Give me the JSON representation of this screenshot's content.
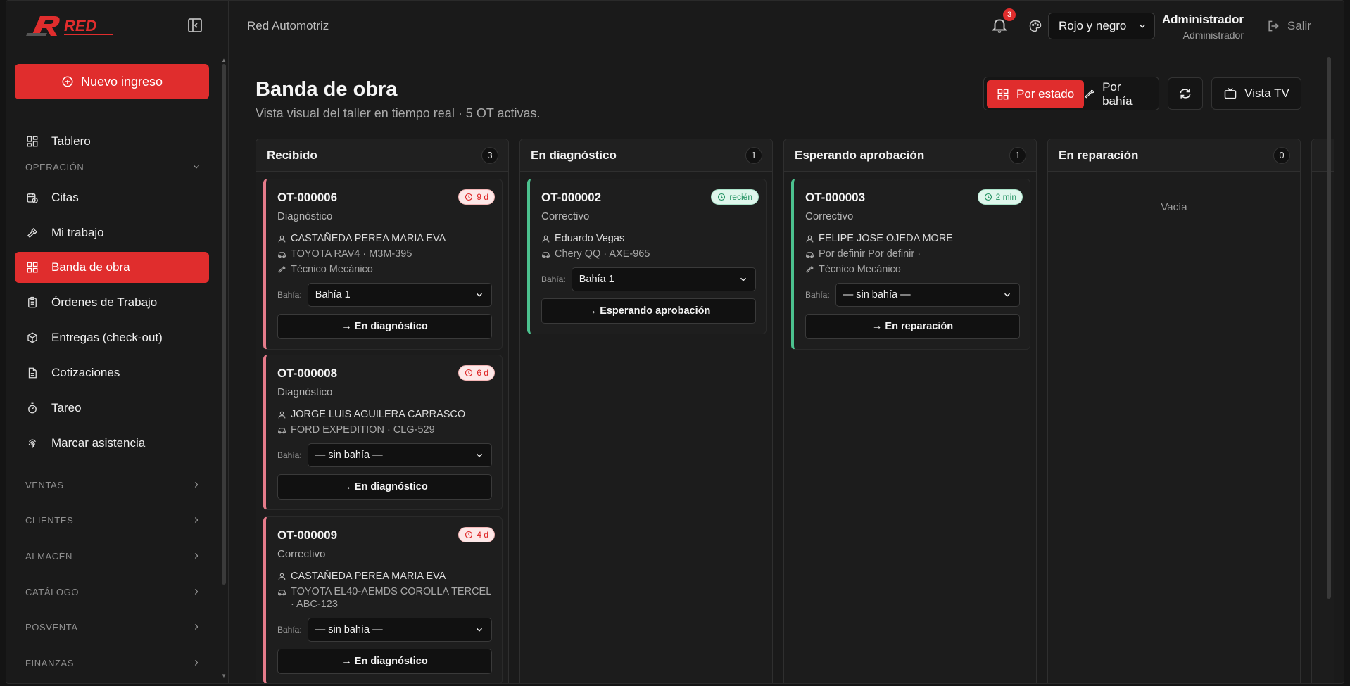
{
  "app": {
    "title": "Red Automotriz",
    "logo_text": "RED"
  },
  "sidebar": {
    "new_button": "Nuevo ingreso",
    "dashboard": "Tablero",
    "sections": [
      {
        "label": "OPERACIÓN",
        "expanded": true
      },
      {
        "label": "VENTAS"
      },
      {
        "label": "CLIENTES"
      },
      {
        "label": "ALMACÉN"
      },
      {
        "label": "CATÁLOGO"
      },
      {
        "label": "POSVENTA"
      },
      {
        "label": "FINANZAS"
      }
    ],
    "items": [
      {
        "label": "Citas",
        "icon": "calendar-clock-icon"
      },
      {
        "label": "Mi trabajo",
        "icon": "hammer-icon"
      },
      {
        "label": "Banda de obra",
        "icon": "grid-icon",
        "active": true
      },
      {
        "label": "Órdenes de Trabajo",
        "icon": "clipboard-icon"
      },
      {
        "label": "Entregas (check-out)",
        "icon": "package-icon"
      },
      {
        "label": "Cotizaciones",
        "icon": "document-icon"
      },
      {
        "label": "Tareo",
        "icon": "timer-icon"
      },
      {
        "label": "Marcar asistencia",
        "icon": "fingerprint-icon"
      }
    ]
  },
  "topbar": {
    "notifications_count": "3",
    "theme": "Rojo y negro",
    "user_name": "Administrador",
    "user_role": "Administrador",
    "logout": "Salir"
  },
  "page": {
    "title": "Banda de obra",
    "subtitle": "Vista visual del taller en tiempo real · 5 OT activas.",
    "view_by_status": "Por estado",
    "view_by_bay": "Por bahía",
    "tv_view": "Vista TV"
  },
  "bay_label": "Bahía:",
  "columns": [
    {
      "title": "Recibido",
      "count": "3",
      "cards": [
        {
          "id": "OT-000006",
          "time": "9 d",
          "type": "Diagnóstico",
          "client": "CASTAÑEDA PEREA MARIA EVA",
          "vehicle": "TOYOTA RAV4 · M3M-395",
          "tech": "Técnico Mecánico",
          "bay": "Bahía 1",
          "action": "→ En diagnóstico"
        },
        {
          "id": "OT-000008",
          "time": "6 d",
          "type": "Diagnóstico",
          "client": "JORGE LUIS AGUILERA CARRASCO",
          "vehicle": "FORD EXPEDITION · CLG-529",
          "bay": "— sin bahía —",
          "action": "→ En diagnóstico"
        },
        {
          "id": "OT-000009",
          "time": "4 d",
          "type": "Correctivo",
          "client": "CASTAÑEDA PEREA MARIA EVA",
          "vehicle": "TOYOTA EL40-AEMDS COROLLA TERCEL · ABC-123",
          "bay": "— sin bahía —",
          "action": "→ En diagnóstico"
        }
      ]
    },
    {
      "title": "En diagnóstico",
      "count": "1",
      "cards": [
        {
          "id": "OT-000002",
          "time": "recién",
          "type": "Correctivo",
          "client": "Eduardo Vegas",
          "vehicle": "Chery QQ · AXE-965",
          "bay": "Bahía 1",
          "action": "→ Esperando aprobación"
        }
      ]
    },
    {
      "title": "Esperando aprobación",
      "count": "1",
      "cards": [
        {
          "id": "OT-000003",
          "time": "2 min",
          "type": "Correctivo",
          "client": "FELIPE JOSE OJEDA MORE",
          "vehicle": "Por definir Por definir ·",
          "tech": "Técnico Mecánico",
          "bay": "— sin bahía —",
          "action": "→ En reparación"
        }
      ]
    },
    {
      "title": "En reparación",
      "count": "0",
      "empty": "Vacía"
    }
  ],
  "colors": {
    "accent": "#e02d2d",
    "card_red_border": "#e57b8a",
    "card_green_border": "#4cc28f"
  }
}
